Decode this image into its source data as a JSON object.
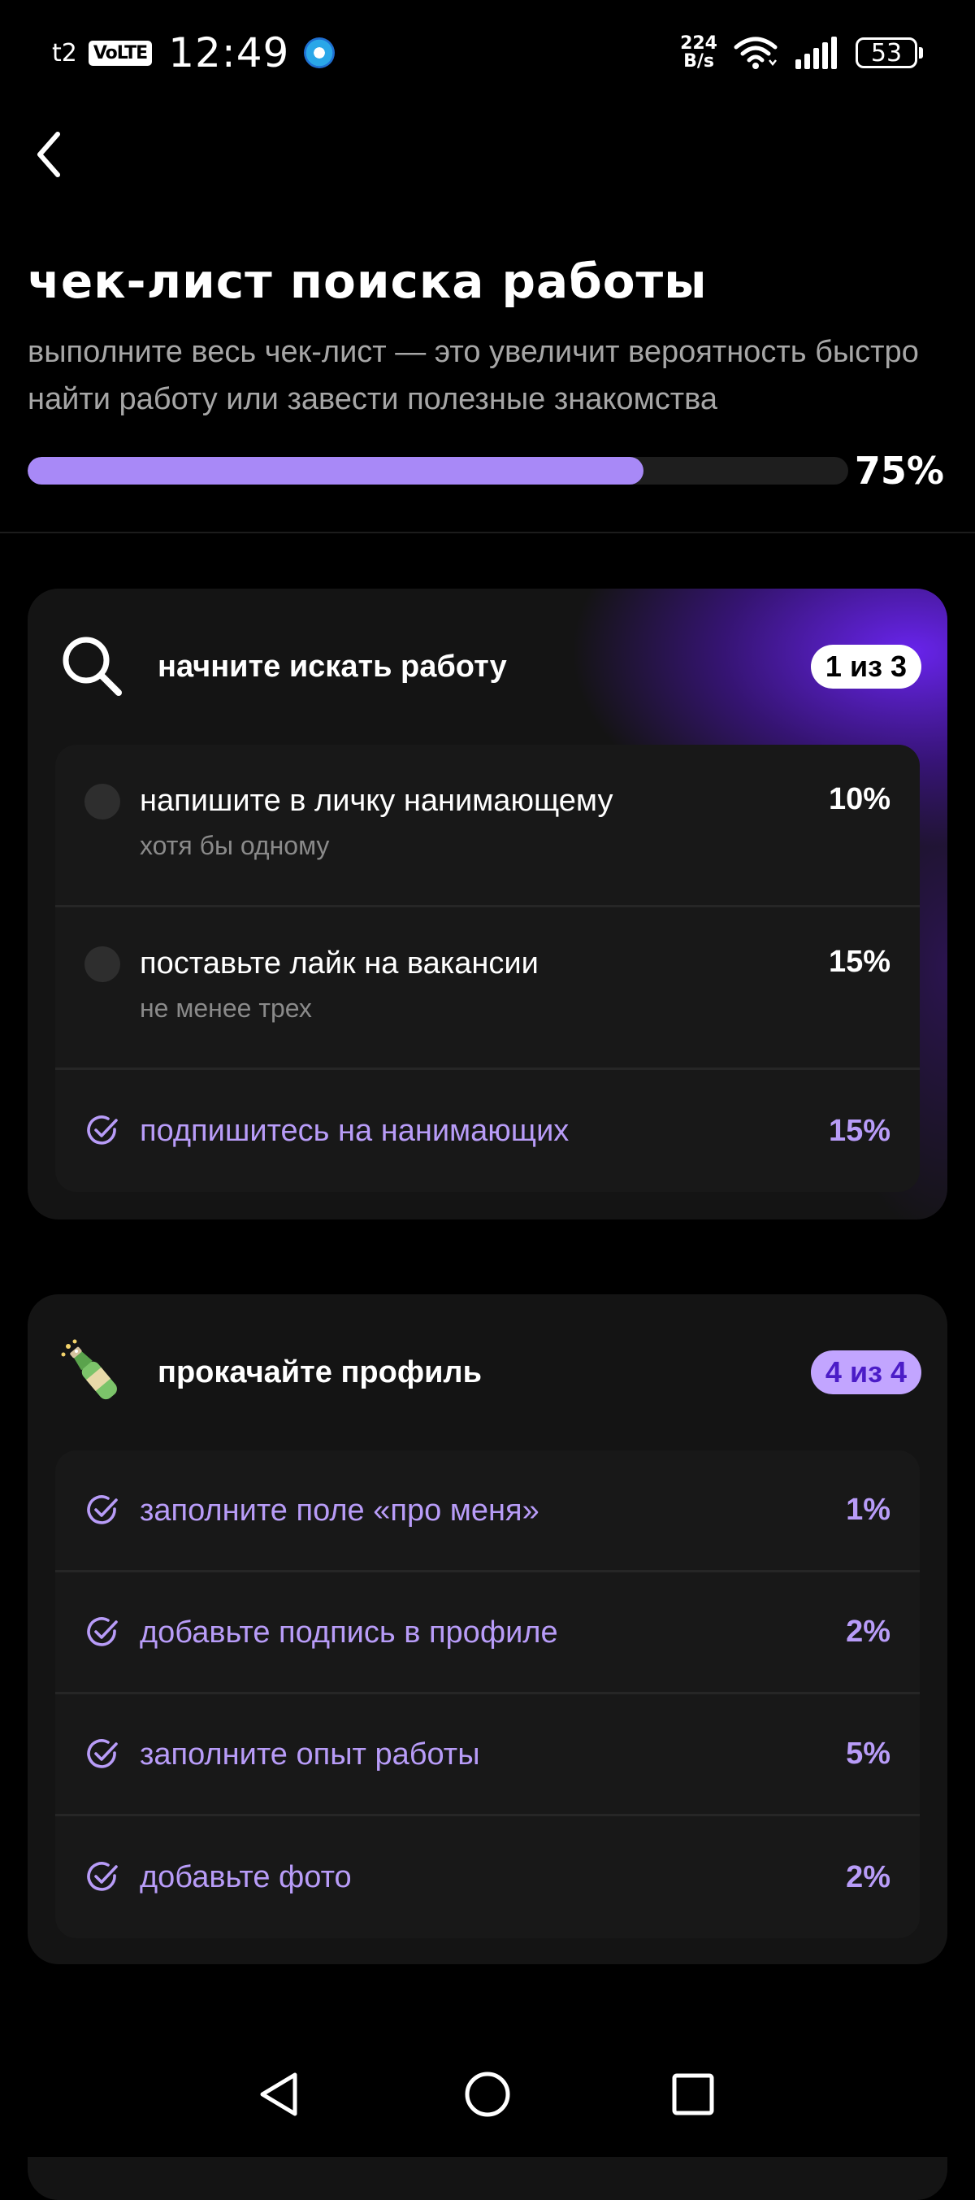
{
  "status_bar": {
    "carrier": "t2",
    "volte": "VoLTE",
    "time": "12:49",
    "speed_value": "224",
    "speed_unit": "B/s",
    "battery": "53"
  },
  "header": {
    "title": "чек-лист поиска работы",
    "subtitle": "выполните весь чек-лист — это увеличит вероятность быстро найти работу или завести полезные знакомства",
    "progress": 75,
    "progress_label": "75%"
  },
  "colors": {
    "accent": "#a889f7",
    "done_text": "#b89cf8",
    "card_bg": "#141414",
    "gradient": "#6a24f0"
  },
  "sections": [
    {
      "icon": "magnifier-icon",
      "title": "начните искать работу",
      "badge": "1 из 3",
      "tasks": [
        {
          "title": "напишите в личку нанимающему",
          "hint": "хотя бы одному",
          "percent": "10%",
          "done": false
        },
        {
          "title": "поставьте лайк на вакансии",
          "hint": "не менее трех",
          "percent": "15%",
          "done": false
        },
        {
          "title": "подпишитесь на нанимающих",
          "hint": "",
          "percent": "15%",
          "done": true
        }
      ]
    },
    {
      "icon": "champagne-icon",
      "title": "прокачайте профиль",
      "badge": "4 из 4",
      "tasks": [
        {
          "title": "заполните поле «про меня»",
          "percent": "1%",
          "done": true
        },
        {
          "title": "добавьте подпись в профиле",
          "percent": "2%",
          "done": true
        },
        {
          "title": "заполните опыт работы",
          "percent": "5%",
          "done": true
        },
        {
          "title": "добавьте фото",
          "percent": "2%",
          "done": true
        }
      ]
    }
  ]
}
